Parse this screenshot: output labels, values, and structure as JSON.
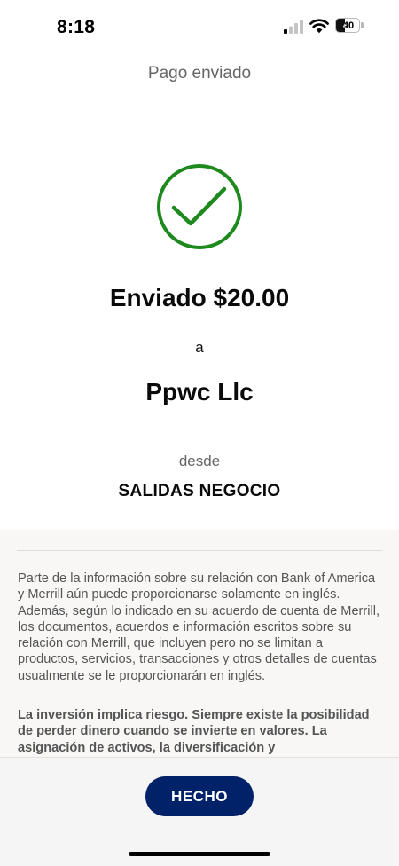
{
  "status_bar": {
    "time": "8:18",
    "battery": "40",
    "battery_level": 0.4,
    "icons": [
      "signal-icon",
      "wifi-icon",
      "battery-icon"
    ]
  },
  "header": {
    "title": "Pago enviado"
  },
  "confirmation": {
    "icon": "checkmark-circle-icon",
    "amount_text": "Enviado $20.00",
    "to_label": "a",
    "recipient": "Ppwc Llc",
    "from_label": "desde",
    "account": "SALIDAS NEGOCIO"
  },
  "disclosure": {
    "paragraph": "Parte de la información sobre su relación con Bank of America y Merrill aún puede proporcionarse solamente en inglés. Además, según lo indicado en su acuerdo de cuenta de Merrill, los documentos, acuerdos e información escritos sobre su relación con Merrill, que incluyen pero no se limitan a productos, servicios, transacciones y otros detalles de cuentas usualmente se le proporcionarán en inglés.",
    "bold_paragraph": "La inversión implica riesgo. Siempre existe la posibilidad de perder dinero cuando se invierte en valores. La asignación de activos, la diversificación y"
  },
  "footer": {
    "done_label": "HECHO"
  },
  "colors": {
    "success_green": "#1e8a1e",
    "button_navy": "#012169",
    "muted_text": "#666666"
  }
}
